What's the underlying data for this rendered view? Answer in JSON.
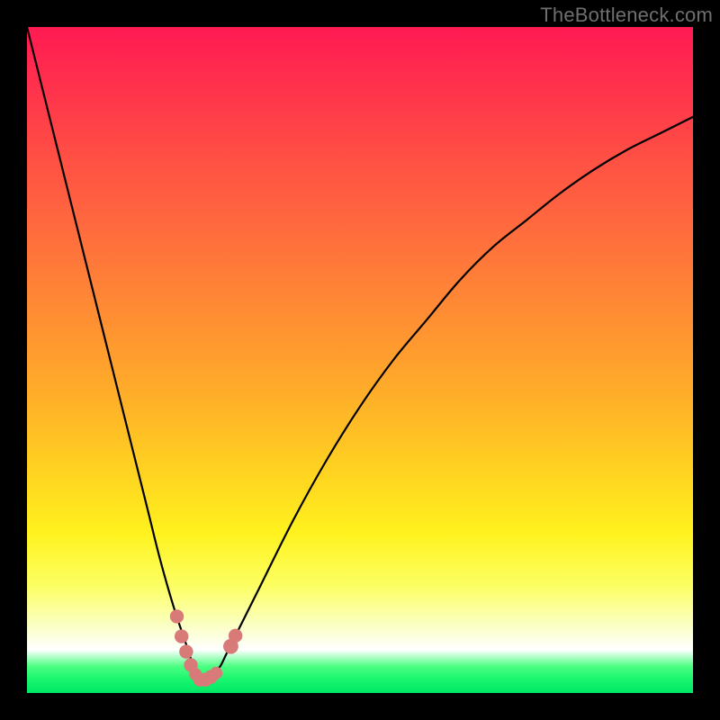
{
  "watermark": "TheBottleneck.com",
  "colors": {
    "frame": "#000000",
    "curve": "#000000",
    "marker": "#d87a78"
  },
  "chart_data": {
    "type": "line",
    "title": "",
    "xlabel": "",
    "ylabel": "",
    "xlim": [
      0,
      100
    ],
    "ylim": [
      0,
      100
    ],
    "grid": false,
    "legend": false,
    "note": "Bottleneck-style V curve. x = normalized component scale (0–100). y = bottleneck percentage (0 = balanced at bottom, 100 = worst at top). Minimum (optimal balance) near x ≈ 26.",
    "series": [
      {
        "name": "bottleneck-curve",
        "x": [
          0,
          3,
          6,
          9,
          12,
          15,
          18,
          20,
          22,
          24,
          25,
          26,
          27,
          28,
          29,
          30,
          32,
          35,
          40,
          45,
          50,
          55,
          60,
          65,
          70,
          75,
          80,
          85,
          90,
          95,
          100
        ],
        "y": [
          100,
          88,
          76,
          64,
          52,
          40,
          28,
          20,
          13,
          7,
          4,
          2,
          2,
          3,
          4,
          6,
          10,
          16,
          26,
          35,
          43,
          50,
          56,
          62,
          67,
          71,
          75,
          78.5,
          81.5,
          84,
          86.5
        ]
      }
    ],
    "markers": {
      "name": "highlight-dots",
      "note": "Salmon dots clustered near the curve minimum (balanced region).",
      "points": [
        {
          "x": 22.5,
          "y": 11.5,
          "r": 1.1
        },
        {
          "x": 23.2,
          "y": 8.5,
          "r": 1.1
        },
        {
          "x": 23.9,
          "y": 6.2,
          "r": 1.1
        },
        {
          "x": 24.6,
          "y": 4.2,
          "r": 1.1
        },
        {
          "x": 25.3,
          "y": 2.8,
          "r": 1.0
        },
        {
          "x": 26.0,
          "y": 2.0,
          "r": 1.1
        },
        {
          "x": 26.8,
          "y": 2.0,
          "r": 1.1
        },
        {
          "x": 27.6,
          "y": 2.4,
          "r": 1.1
        },
        {
          "x": 28.4,
          "y": 3.0,
          "r": 1.0
        },
        {
          "x": 30.6,
          "y": 7.0,
          "r": 1.2
        },
        {
          "x": 31.3,
          "y": 8.6,
          "r": 1.1
        }
      ]
    }
  }
}
